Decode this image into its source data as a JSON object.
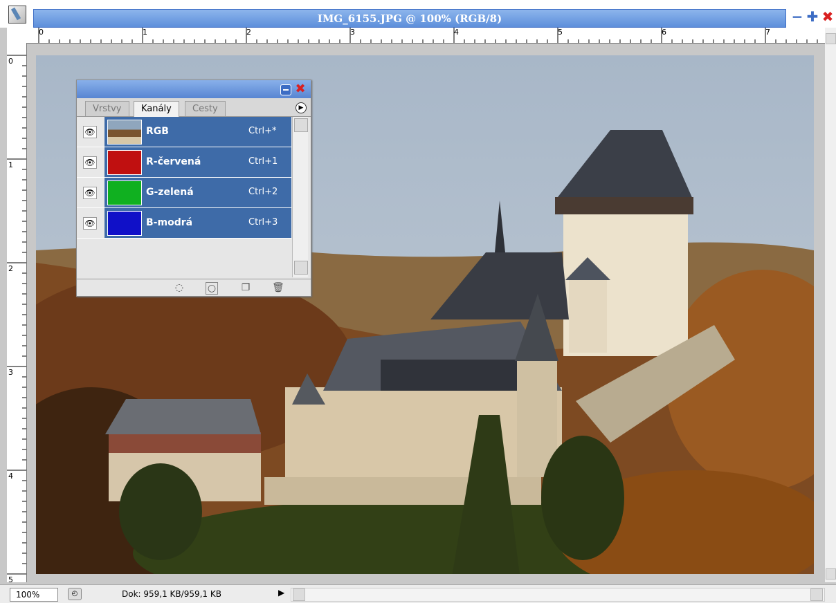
{
  "window": {
    "title": "IMG_6155.JPG @ 100% (RGB/8)",
    "icon": "photoshop-feather-icon",
    "controls": [
      "minimize-icon",
      "restore-icon",
      "close-icon"
    ]
  },
  "ruler": {
    "top_labels": [
      "0",
      "1",
      "2",
      "3",
      "4",
      "5",
      "6",
      "7"
    ],
    "left_labels": [
      "0",
      "1",
      "2",
      "3",
      "4",
      "5"
    ]
  },
  "channels_panel": {
    "tabs": [
      "Vrstvy",
      "Kanály",
      "Cesty"
    ],
    "active_tab": "Kanály",
    "channels": [
      {
        "name": "RGB",
        "shortcut": "Ctrl+*",
        "thumb_color": "#7a7668"
      },
      {
        "name": "R-červená",
        "shortcut": "Ctrl+1",
        "thumb_color": "#c01010"
      },
      {
        "name": "G-zelená",
        "shortcut": "Ctrl+2",
        "thumb_color": "#10b020"
      },
      {
        "name": "B-modrá",
        "shortcut": "Ctrl+3",
        "thumb_color": "#1010c8"
      }
    ],
    "footer_icons": [
      "load-selection-icon",
      "save-selection-icon",
      "new-channel-icon",
      "delete-channel-icon"
    ]
  },
  "status": {
    "zoom": "100%",
    "doc_info": "Dok: 959,1 KB/959,1 KB"
  },
  "colors": {
    "titlebar": "#5d8fdb",
    "channel_selected": "#3e6ba8"
  }
}
